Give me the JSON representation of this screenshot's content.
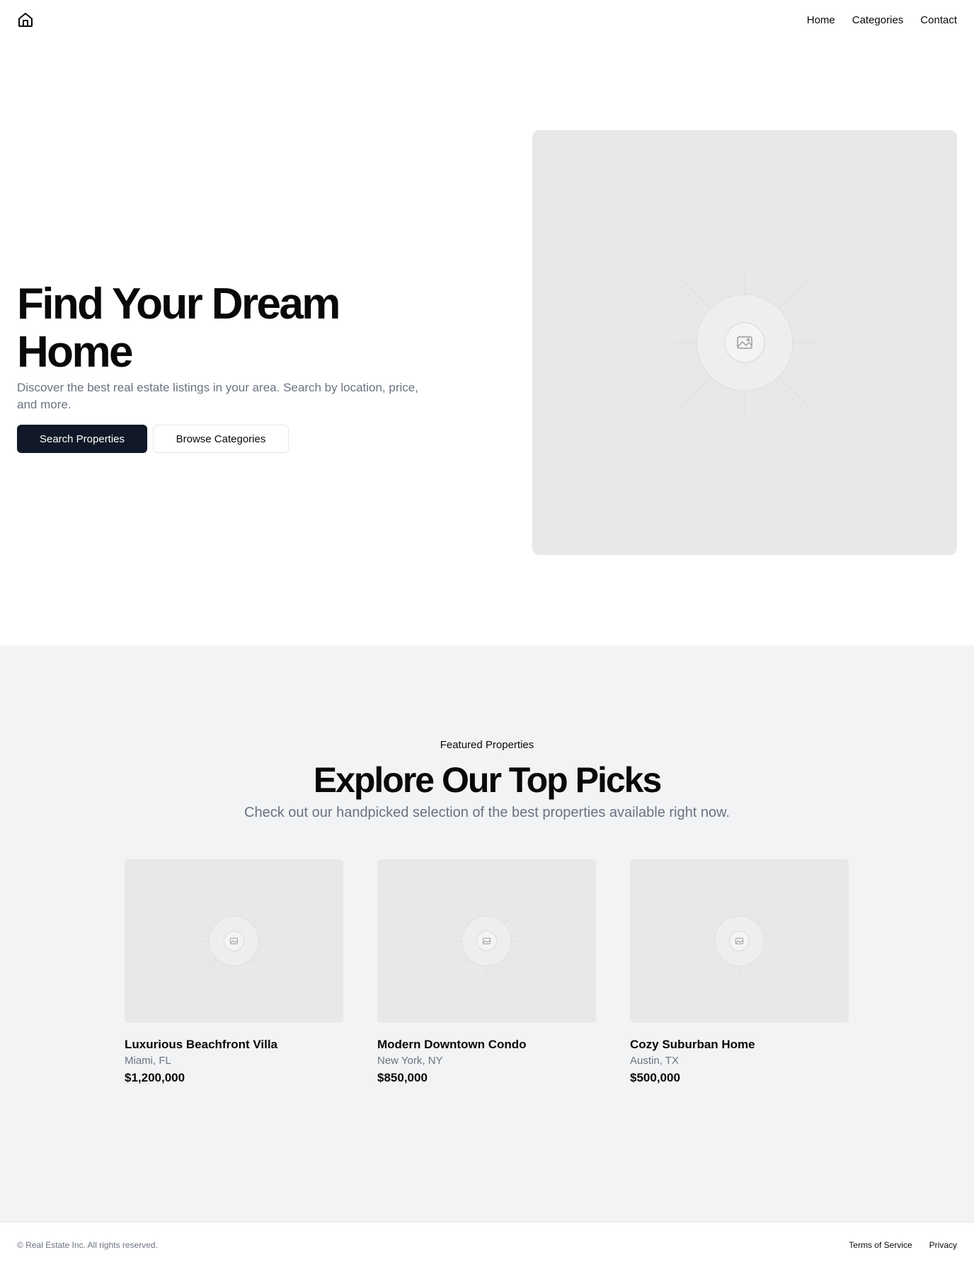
{
  "header": {
    "logo_icon": "home-icon",
    "nav": [
      {
        "label": "Home"
      },
      {
        "label": "Categories"
      },
      {
        "label": "Contact"
      }
    ]
  },
  "hero": {
    "title": "Find Your Dream Home",
    "subtitle": "Discover the best real estate listings in your area. Search by location, price, and more.",
    "primary_button": "Search Properties",
    "secondary_button": "Browse Categories",
    "image_icon": "image-placeholder-icon"
  },
  "featured": {
    "eyebrow": "Featured Properties",
    "title": "Explore Our Top Picks",
    "subtitle": "Check out our handpicked selection of the best properties available right now.",
    "cards": [
      {
        "title": "Luxurious Beachfront Villa",
        "location": "Miami, FL",
        "price": "$1,200,000"
      },
      {
        "title": "Modern Downtown Condo",
        "location": "New York, NY",
        "price": "$850,000"
      },
      {
        "title": "Cozy Suburban Home",
        "location": "Austin, TX",
        "price": "$500,000"
      }
    ]
  },
  "footer": {
    "copyright": "© Real Estate Inc. All rights reserved.",
    "links": [
      {
        "label": "Terms of Service"
      },
      {
        "label": "Privacy"
      }
    ]
  },
  "colors": {
    "primary": "#111827",
    "muted_text": "#6b7280",
    "section_bg": "#f2f3f5",
    "placeholder_bg": "#e8e8e8"
  }
}
